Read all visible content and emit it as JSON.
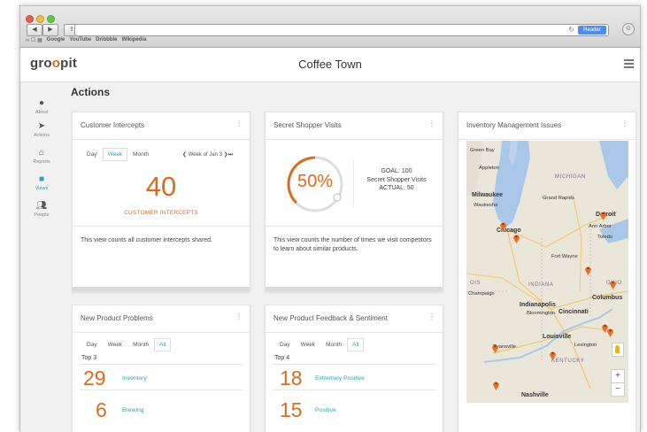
{
  "browser": {
    "reader_label": "Reader",
    "bookmarks": [
      "Google",
      "YouTube",
      "Dribbble",
      "Wikipedia"
    ]
  },
  "app": {
    "logo": "groopit",
    "title": "Coffee Town"
  },
  "sidebar": {
    "items": [
      {
        "label": "About",
        "icon": "info-icon"
      },
      {
        "label": "Actions",
        "icon": "send-icon"
      },
      {
        "label": "Reports",
        "icon": "home-icon"
      },
      {
        "label": "Views",
        "icon": "square-icon",
        "active": true
      },
      {
        "label": "People",
        "icon": "people-icon"
      }
    ]
  },
  "section_title": "Actions",
  "cards": {
    "customer_intercepts": {
      "title": "Customer Intercepts",
      "periods": [
        "Day",
        "Week",
        "Month"
      ],
      "selected_period": "Week",
      "week_of": "Week of Jan 3",
      "value": "40",
      "value_label": "CUSTOMER INTERCEPTS",
      "description": "This view counts all customer intercepts shared."
    },
    "secret_shopper": {
      "title": "Secret Shopper Visits",
      "percent_label": "50%",
      "percent": 50,
      "goal": "GOAL: 100",
      "metric": "Secret Shopper Visits",
      "actual": "ACTUAL: 50",
      "description": "This view counts the number of times we visit competitors to learn about similar products."
    },
    "inventory": {
      "title": "Inventory Management Issues",
      "map_labels": {
        "green_bay": "Green Bay",
        "appleton": "Appleton",
        "michigan": "MICHIGAN",
        "milwaukee": "Milwaukee",
        "waukesha": "Waukesha",
        "grand_rapids": "Grand Rapids",
        "detroit": "Detroit",
        "ann_arbor": "Ann Arbor",
        "toledo": "Toledo",
        "chicago": "Chicago",
        "fort_wayne": "Fort Wayne",
        "indiana": "INDIANA",
        "ohio": "OHIO",
        "columbus": "Columbus",
        "ois": "OIS",
        "champaign": "Champaign",
        "indianapolis": "Indianapolis",
        "bloomington": "Bloomington",
        "cincinnati": "Cincinnati",
        "louisville": "Louisville",
        "evansville": "Evansville",
        "lexington": "Lexington",
        "kentucky": "KENTUCKY",
        "nashville": "Nashville"
      },
      "zoom_in": "+",
      "zoom_out": "−"
    },
    "new_product_problems": {
      "title": "New Product Problems",
      "periods": [
        "Day",
        "Week",
        "Month",
        "All"
      ],
      "selected_period": "All",
      "top_label": "Top 3",
      "rows": [
        {
          "value": "29",
          "name": "Inventory"
        },
        {
          "value": "6",
          "name": "Brewing"
        }
      ]
    },
    "new_product_feedback": {
      "title": "New Product Feedback & Sentiment",
      "periods": [
        "Day",
        "Week",
        "Month",
        "All"
      ],
      "selected_period": "All",
      "top_label": "Top 4",
      "rows": [
        {
          "value": "18",
          "name": "Extremely Positive"
        },
        {
          "value": "15",
          "name": "Positive"
        }
      ]
    }
  },
  "colors": {
    "accent": "#e06a1b",
    "teal": "#2aa5b3",
    "pin": "#e8702a"
  }
}
